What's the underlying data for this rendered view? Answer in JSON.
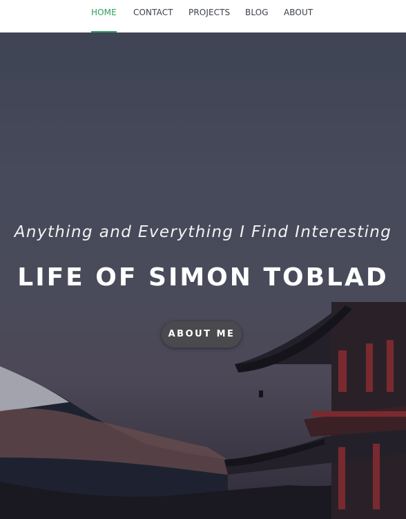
{
  "nav": {
    "items": [
      {
        "label": "HOME",
        "active": true
      },
      {
        "label": "CONTACT"
      },
      {
        "label": "PROJECTS"
      },
      {
        "label": "BLOG"
      },
      {
        "label": "ABOUT"
      }
    ],
    "active_color": "#2e9d5d"
  },
  "hero": {
    "subtitle": "Anything and Everything I Find Interesting",
    "title": "LIFE OF SIMON TOBLAD",
    "button_label": "ABOUT ME"
  }
}
